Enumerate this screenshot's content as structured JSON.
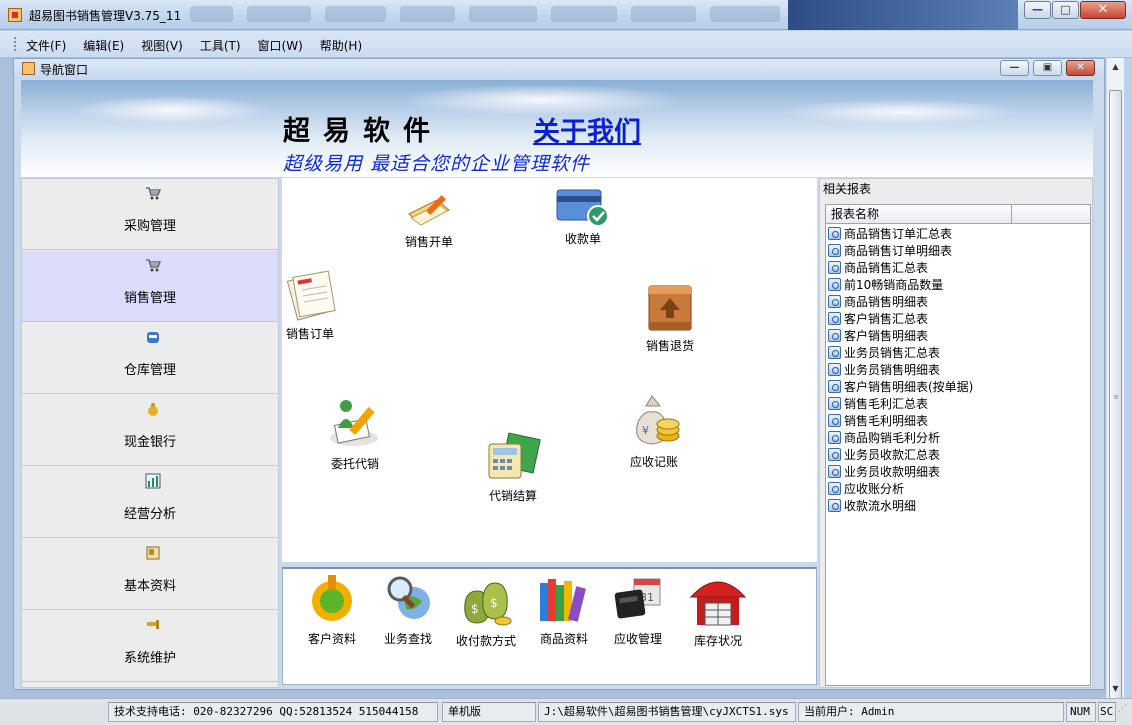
{
  "window": {
    "title": "超易图书销售管理V3.75_11"
  },
  "menu": {
    "items": [
      "文件(F)",
      "编辑(E)",
      "视图(V)",
      "工具(T)",
      "窗口(W)",
      "帮助(H)"
    ]
  },
  "child": {
    "title": "导航窗口"
  },
  "banner": {
    "brand": "超易软件",
    "about": "关于我们",
    "slogan": "超级易用 最适合您的企业管理软件"
  },
  "nav": {
    "items": [
      {
        "label": "采购管理",
        "icon": "cart-icon"
      },
      {
        "label": "销售管理",
        "icon": "cart-icon",
        "active": true
      },
      {
        "label": "仓库管理",
        "icon": "warehouse-icon"
      },
      {
        "label": "现金银行",
        "icon": "money-bag-icon"
      },
      {
        "label": "经营分析",
        "icon": "chart-icon"
      },
      {
        "label": "基本资料",
        "icon": "folder-icon"
      },
      {
        "label": "系统维护",
        "icon": "wrench-icon"
      }
    ]
  },
  "center": {
    "sales_invoice": "销售开单",
    "receipt": "收款单",
    "sales_order": "销售订单",
    "sales_return": "销售退货",
    "consignment": "委托代销",
    "receivable": "应收记账",
    "consign_settle": "代销结算"
  },
  "toolbar": {
    "customer": "客户资料",
    "query": "业务查找",
    "payment": "收付款方式",
    "product": "商品资料",
    "ar_manage": "应收管理",
    "stock": "库存状况"
  },
  "reports": {
    "title": "相关报表",
    "column": "报表名称",
    "items": [
      "商品销售订单汇总表",
      "商品销售订单明细表",
      "商品销售汇总表",
      "前10畅销商品数量",
      "商品销售明细表",
      "客户销售汇总表",
      "客户销售明细表",
      "业务员销售汇总表",
      "业务员销售明细表",
      "客户销售明细表(按单据)",
      "销售毛利汇总表",
      "销售毛利明细表",
      "商品购销毛利分析",
      "业务员收款汇总表",
      "业务员收款明细表",
      "应收账分析",
      "收款流水明细"
    ]
  },
  "status": {
    "support": "技术支持电话: 020-82327296 QQ:52813524 515044158",
    "edition": "单机版",
    "path": "J:\\超易软件\\超易图书销售管理\\cyJXCTS1.sys",
    "user": "当前用户: Admin",
    "num": "NUM",
    "scr": "SC"
  },
  "colors": {
    "brand_blue": "#0b1fd9",
    "active_nav": "#dbdcf9",
    "selection": "#3a75d4"
  }
}
